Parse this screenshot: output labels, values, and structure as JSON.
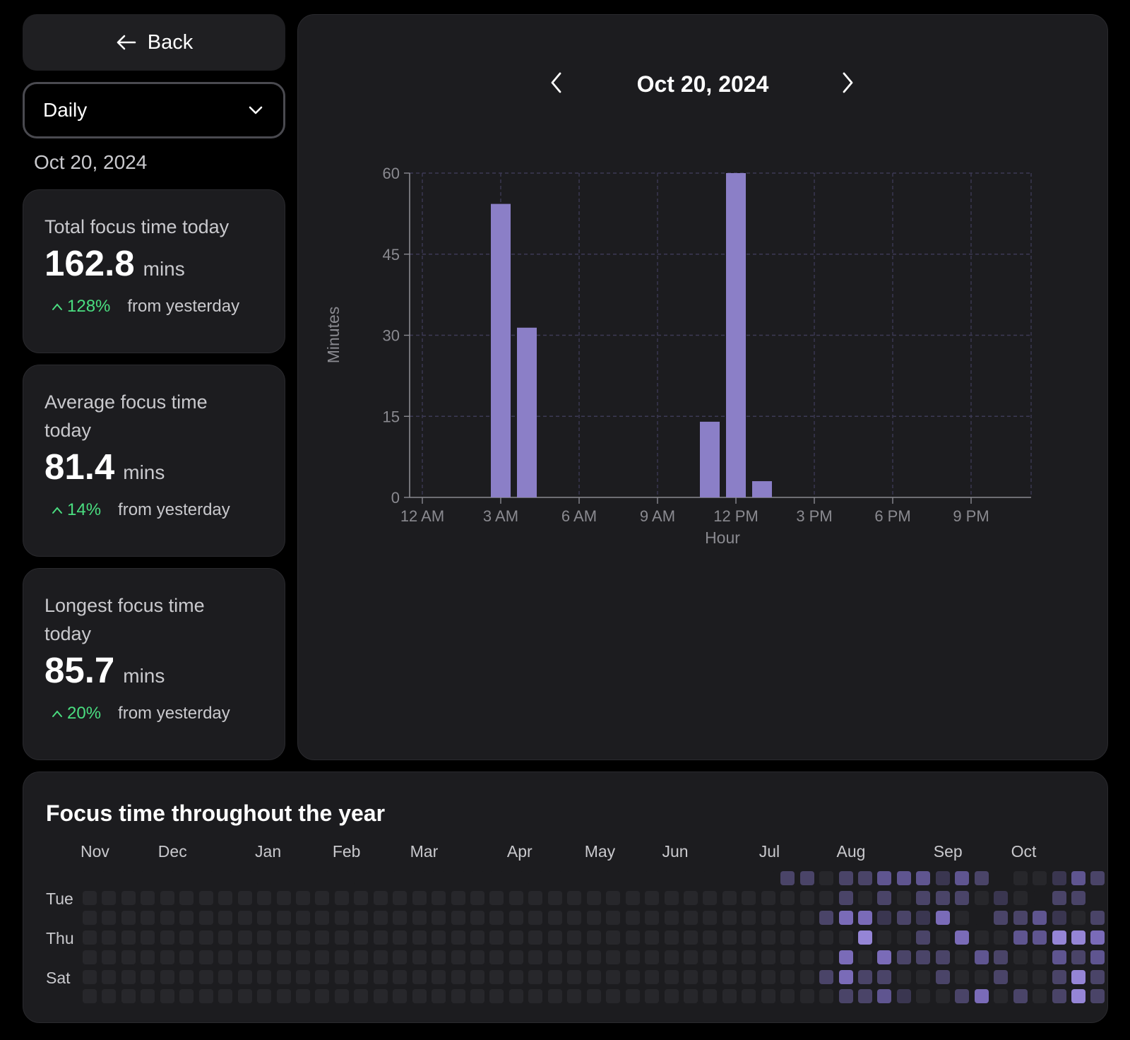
{
  "back": {
    "label": "Back",
    "icon": "arrow-left-icon"
  },
  "period_select": {
    "value": "Daily",
    "icon": "chevron-down-icon"
  },
  "side_date": "Oct 20, 2024",
  "stats": [
    {
      "label": "Total focus time today",
      "value": "162.8",
      "unit": "mins",
      "change": "128%",
      "change_suffix": "from yesterday"
    },
    {
      "label": "Average focus time today",
      "value": "81.4",
      "unit": "mins",
      "change": "14%",
      "change_suffix": "from yesterday"
    },
    {
      "label": "Longest focus time today",
      "value": "85.7",
      "unit": "mins",
      "change": "20%",
      "change_suffix": "from yesterday"
    }
  ],
  "chart_nav": {
    "title": "Oct 20, 2024",
    "prev_icon": "chevron-left-icon",
    "next_icon": "chevron-right-icon"
  },
  "chart_data": {
    "type": "bar",
    "title": "Oct 20, 2024",
    "xlabel": "Hour",
    "ylabel": "Minutes",
    "ylim": [
      0,
      60
    ],
    "yticks": [
      0,
      15,
      30,
      45,
      60
    ],
    "xlim": [
      0,
      24
    ],
    "xticks": [
      {
        "value": 0,
        "label": "12 AM"
      },
      {
        "value": 3,
        "label": "3 AM"
      },
      {
        "value": 6,
        "label": "6 AM"
      },
      {
        "value": 9,
        "label": "9 AM"
      },
      {
        "value": 12,
        "label": "12 PM"
      },
      {
        "value": 15,
        "label": "3 PM"
      },
      {
        "value": 18,
        "label": "6 PM"
      },
      {
        "value": 21,
        "label": "9 PM"
      }
    ],
    "grid": true,
    "color": "#8b7fc7",
    "bars": [
      {
        "hour": 3,
        "value": 54.3
      },
      {
        "hour": 4,
        "value": 31.4
      },
      {
        "hour": 11,
        "value": 14
      },
      {
        "hour": 12,
        "value": 60
      },
      {
        "hour": 13,
        "value": 3
      }
    ]
  },
  "year": {
    "title": "Focus time throughout the year",
    "months": [
      {
        "label": "Nov",
        "week": 0
      },
      {
        "label": "Dec",
        "week": 4
      },
      {
        "label": "Jan",
        "week": 9
      },
      {
        "label": "Feb",
        "week": 13
      },
      {
        "label": "Mar",
        "week": 17
      },
      {
        "label": "Apr",
        "week": 22
      },
      {
        "label": "May",
        "week": 26
      },
      {
        "label": "Jun",
        "week": 30
      },
      {
        "label": "Jul",
        "week": 35
      },
      {
        "label": "Aug",
        "week": 39
      },
      {
        "label": "Sep",
        "week": 44
      },
      {
        "label": "Oct",
        "week": 48
      }
    ],
    "day_labels": [
      {
        "label": "Tue",
        "row": 1
      },
      {
        "label": "Thu",
        "row": 3
      },
      {
        "label": "Sat",
        "row": 5
      }
    ],
    "weeks": 52,
    "colors": [
      "#1a1a1d",
      "#27272b",
      "#3a3650",
      "#4a4468",
      "#5f5590",
      "#7a6bb8",
      "#9585d6"
    ],
    "heat": [
      "00000000000000000000000000000000000033133444243011243",
      "1111111111111111111111111111111111111113131333121033",
      "11111111111111111111111111111111111111355232510334213",
      "11111111111111111111111111111111111111116113151144665",
      "11111111111111111111111111111111111111151533314311434",
      "11111111111111111111111111111111111111353311311311363",
      "11111111111111111111111111111111111111133421135131363"
    ]
  }
}
